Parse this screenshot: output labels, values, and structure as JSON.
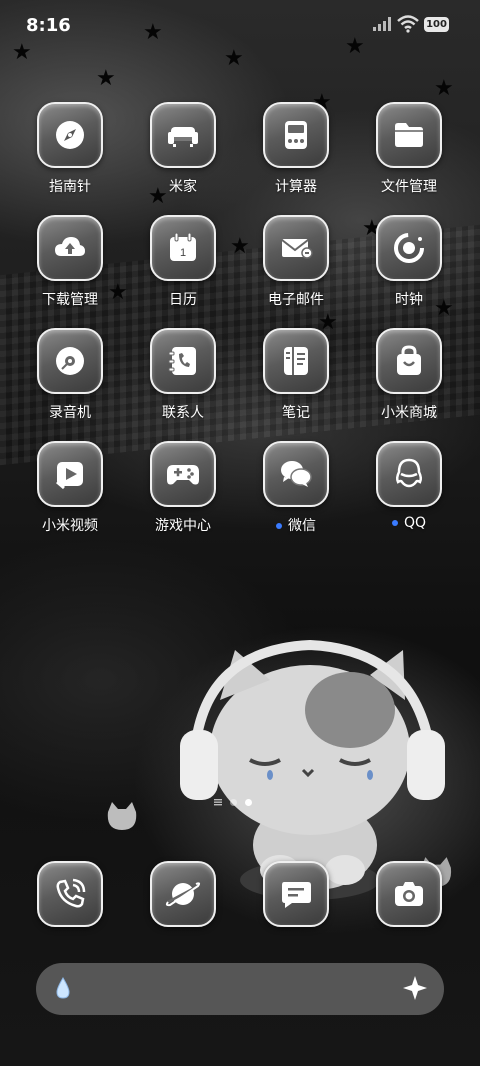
{
  "status_bar": {
    "time": "8:16",
    "battery": "100"
  },
  "apps": [
    {
      "label": "指南针",
      "icon": "compass-icon",
      "notify": false
    },
    {
      "label": "米家",
      "icon": "sofa-icon",
      "notify": false
    },
    {
      "label": "计算器",
      "icon": "calculator-icon",
      "notify": false
    },
    {
      "label": "文件管理",
      "icon": "folder-icon",
      "notify": false
    },
    {
      "label": "下载管理",
      "icon": "cloud-download-icon",
      "notify": false
    },
    {
      "label": "日历",
      "icon": "calendar-icon",
      "notify": false,
      "calendar_day": "1"
    },
    {
      "label": "电子邮件",
      "icon": "mail-icon",
      "notify": false
    },
    {
      "label": "时钟",
      "icon": "clock-icon",
      "notify": false
    },
    {
      "label": "录音机",
      "icon": "recorder-icon",
      "notify": false
    },
    {
      "label": "联系人",
      "icon": "contacts-icon",
      "notify": false
    },
    {
      "label": "笔记",
      "icon": "notes-icon",
      "notify": false
    },
    {
      "label": "小米商城",
      "icon": "shopping-bag-icon",
      "notify": false
    },
    {
      "label": "小米视频",
      "icon": "video-play-icon",
      "notify": false
    },
    {
      "label": "游戏中心",
      "icon": "gamepad-icon",
      "notify": false
    },
    {
      "label": "微信",
      "icon": "chat-bubbles-icon",
      "notify": true
    },
    {
      "label": "QQ",
      "icon": "penguin-icon",
      "notify": true
    }
  ],
  "dock": [
    {
      "name": "phone",
      "icon": "phone-icon"
    },
    {
      "name": "browser",
      "icon": "planet-icon"
    },
    {
      "name": "messages",
      "icon": "message-icon"
    },
    {
      "name": "camera",
      "icon": "camera-icon"
    }
  ],
  "pager": {
    "pages": 2,
    "active": 2
  },
  "colors": {
    "notify_dot": "#3a7bff",
    "tile_border": "#efefef"
  }
}
